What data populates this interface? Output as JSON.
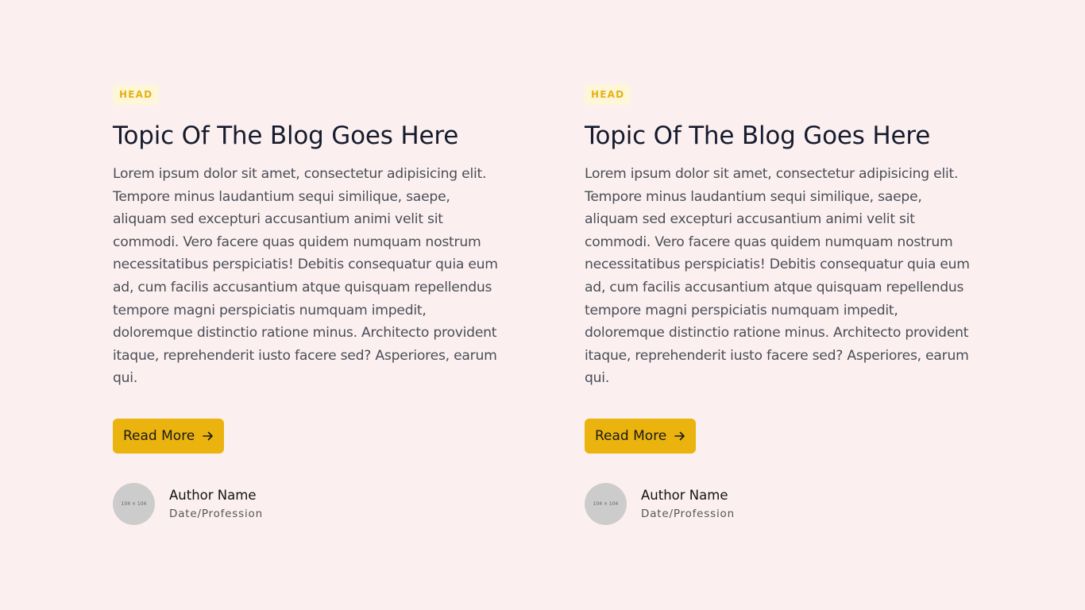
{
  "posts": [
    {
      "tag": "HEAD",
      "title": "Topic Of The Blog Goes Here",
      "body": "Lorem ipsum dolor sit amet, consectetur adipisicing elit. Tempore minus laudantium sequi similique, saepe, aliquam sed excepturi accusantium animi velit sit commodi. Vero facere quas quidem numquam nostrum necessitatibus perspiciatis! Debitis consequatur quia eum ad, cum facilis accusantium atque quisquam repellendus tempore magni perspiciatis numquam impedit, doloremque distinctio ratione minus. Architecto provident itaque, reprehenderit iusto facere sed? Asperiores, earum qui.",
      "button_label": "Read More",
      "avatar_text": "104 × 104",
      "author_name": "Author Name",
      "author_meta": "Date/Profession"
    },
    {
      "tag": "HEAD",
      "title": "Topic Of The Blog Goes Here",
      "body": "Lorem ipsum dolor sit amet, consectetur adipisicing elit. Tempore minus laudantium sequi similique, saepe, aliquam sed excepturi accusantium animi velit sit commodi. Vero facere quas quidem numquam nostrum necessitatibus perspiciatis! Debitis consequatur quia eum ad, cum facilis accusantium atque quisquam repellendus tempore magni perspiciatis numquam impedit, doloremque distinctio ratione minus. Architecto provident itaque, reprehenderit iusto facere sed? Asperiores, earum qui.",
      "button_label": "Read More",
      "avatar_text": "104 × 104",
      "author_name": "Author Name",
      "author_meta": "Date/Profession"
    }
  ],
  "colors": {
    "background": "#fbf0ef",
    "accent": "#ebb30e",
    "tag_bg": "#fdf6d8",
    "tag_text": "#e5b214",
    "avatar": "#cccccc"
  },
  "icons": {
    "button_icon": "arrow-right-icon"
  }
}
